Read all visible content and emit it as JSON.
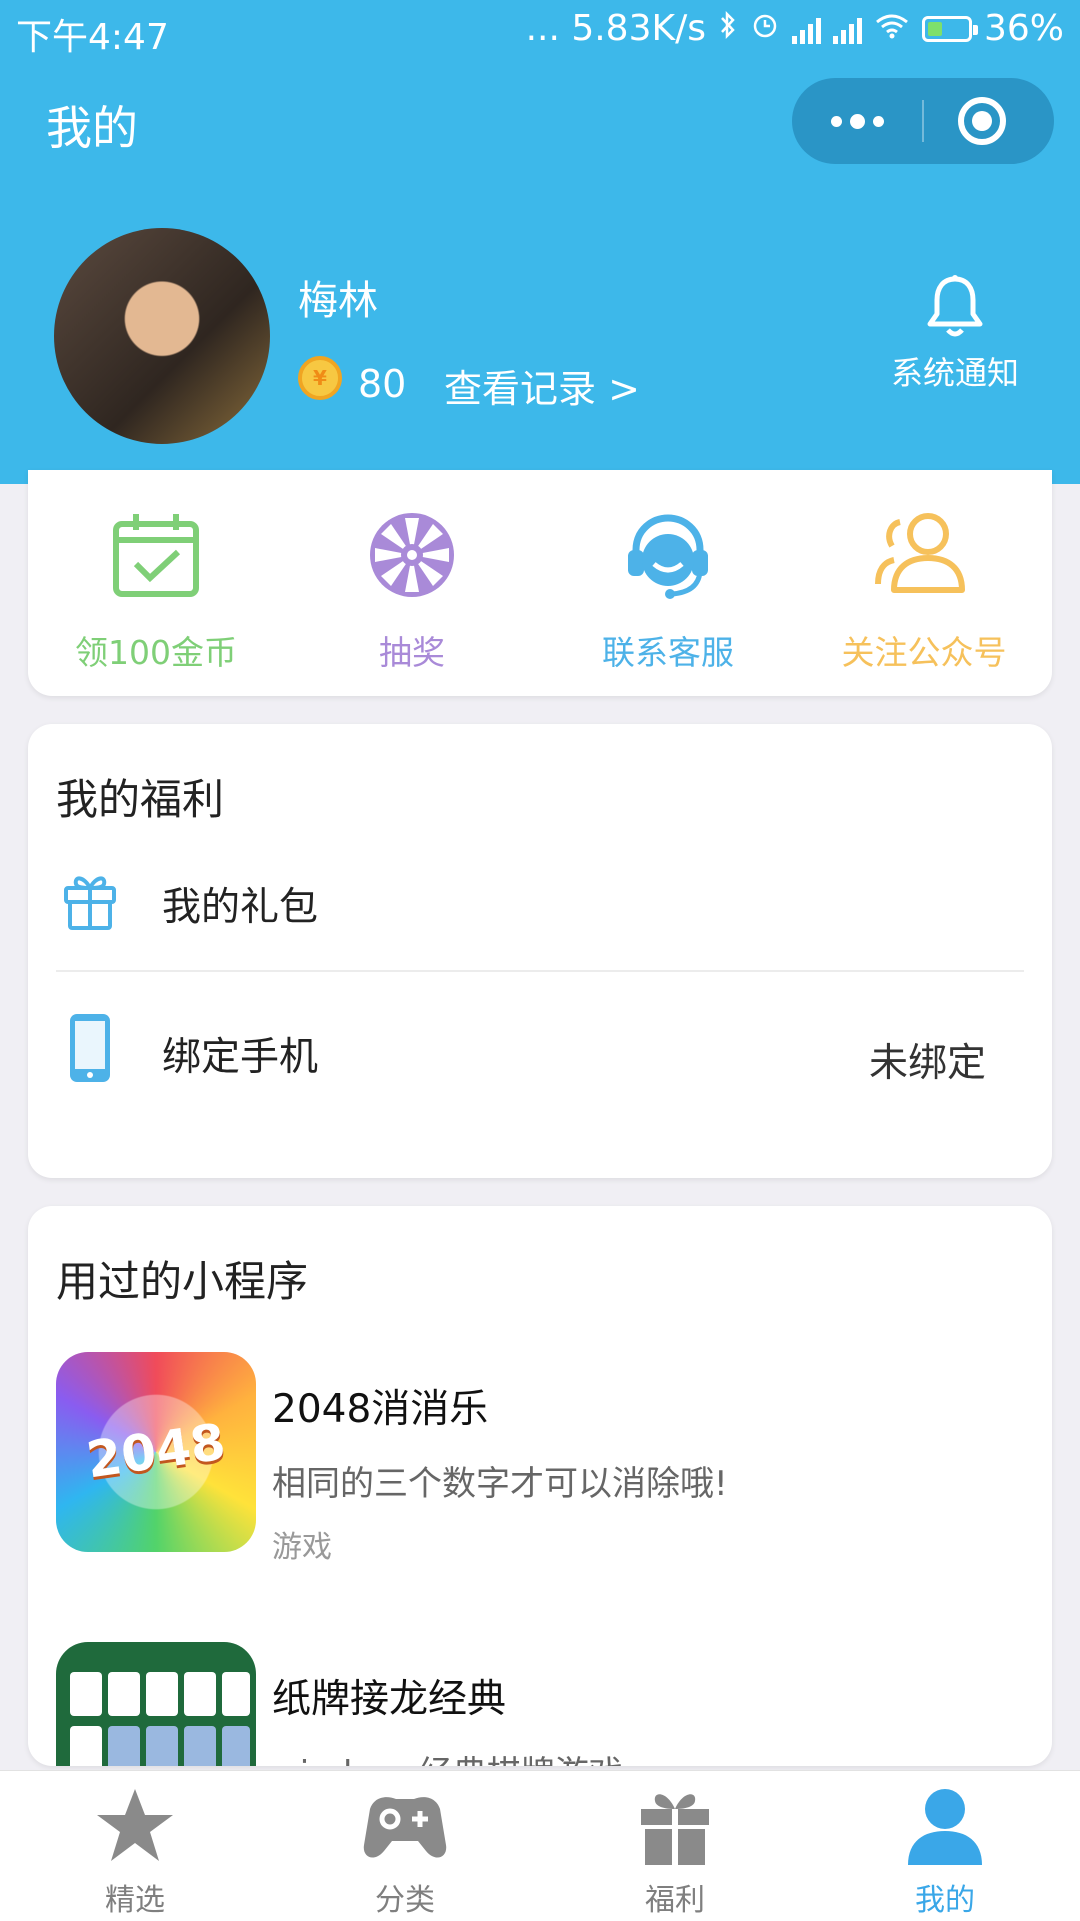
{
  "status_bar": {
    "time": "下午4:47",
    "speed": "... 5.83K/s",
    "battery": "36%"
  },
  "nav": {
    "title": "我的"
  },
  "profile": {
    "name": "梅林",
    "coin_symbol": "¥",
    "coins": "80",
    "record_link": "查看记录 >",
    "notify_label": "系统通知"
  },
  "actions": [
    {
      "label": "领100金币",
      "icon": "calendar-check-icon",
      "color": "#7fcf77"
    },
    {
      "label": "抽奖",
      "icon": "prize-wheel-icon",
      "color": "#a98ad8"
    },
    {
      "label": "联系客服",
      "icon": "customer-service-icon",
      "color": "#4db2e8"
    },
    {
      "label": "关注公众号",
      "icon": "users-icon",
      "color": "#f6c15b"
    }
  ],
  "welfare": {
    "title": "我的福利",
    "items": [
      {
        "label": "我的礼包",
        "icon": "gift-icon"
      },
      {
        "label": "绑定手机",
        "icon": "phone-icon",
        "value": "未绑定"
      }
    ]
  },
  "used_apps": {
    "title": "用过的小程序",
    "items": [
      {
        "name": "2048消消乐",
        "desc": "相同的三个数字才可以消除哦!",
        "category": "游戏",
        "icon_text": "2048"
      },
      {
        "name": "纸牌接龙经典",
        "desc": "windows经典棋牌游戏"
      }
    ]
  },
  "tabbar": {
    "items": [
      {
        "label": "精选",
        "icon": "star-icon",
        "active": false
      },
      {
        "label": "分类",
        "icon": "gamepad-icon",
        "active": false
      },
      {
        "label": "福利",
        "icon": "gift-icon",
        "active": false
      },
      {
        "label": "我的",
        "icon": "person-icon",
        "active": true
      }
    ],
    "active_color": "#3aa7e8",
    "inactive_color": "#8a8a8a"
  }
}
